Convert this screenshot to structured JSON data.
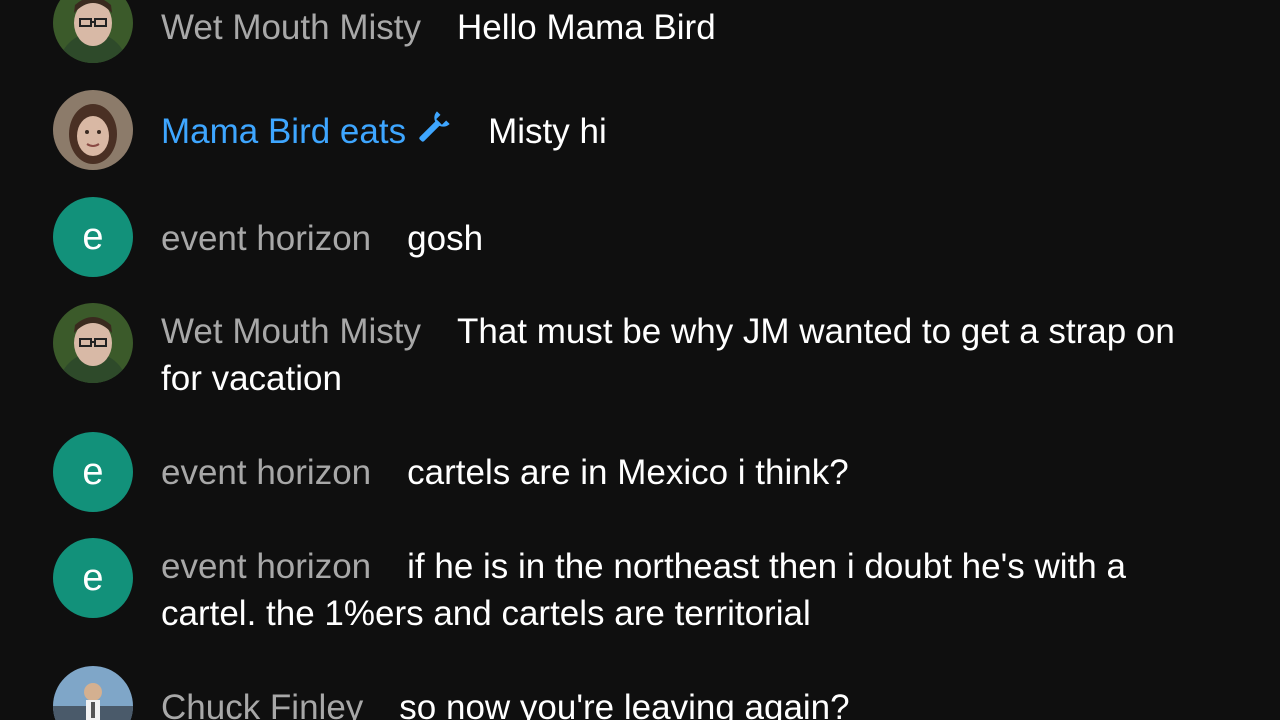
{
  "colors": {
    "background": "#0f0f0f",
    "author_name": "#a8a8a8",
    "moderator_name": "#3ea6ff",
    "message_text": "#ffffff",
    "letter_avatar": "#12917a"
  },
  "messages": [
    {
      "author": "Wet Mouth Misty",
      "text": "Hello Mama Bird",
      "avatar": "photo"
    },
    {
      "author": "Mama Bird eats",
      "badge_icon": "wrench-icon",
      "text": "Misty hi",
      "avatar": "photo"
    },
    {
      "author": "event horizon",
      "text": "gosh",
      "avatar_letter": "e"
    },
    {
      "author": "Wet Mouth Misty",
      "text": "That must be why JM wanted to get a strap on for vacation",
      "avatar": "photo"
    },
    {
      "author": "event horizon",
      "text": "cartels are in Mexico i think?",
      "avatar_letter": "e"
    },
    {
      "author": "event horizon",
      "text": "if he is in the northeast then i doubt he's with a cartel. the 1%ers and cartels are territorial",
      "avatar_letter": "e"
    },
    {
      "author": "Chuck Finley",
      "text": "so now you're leaving again?",
      "avatar": "photo"
    }
  ]
}
